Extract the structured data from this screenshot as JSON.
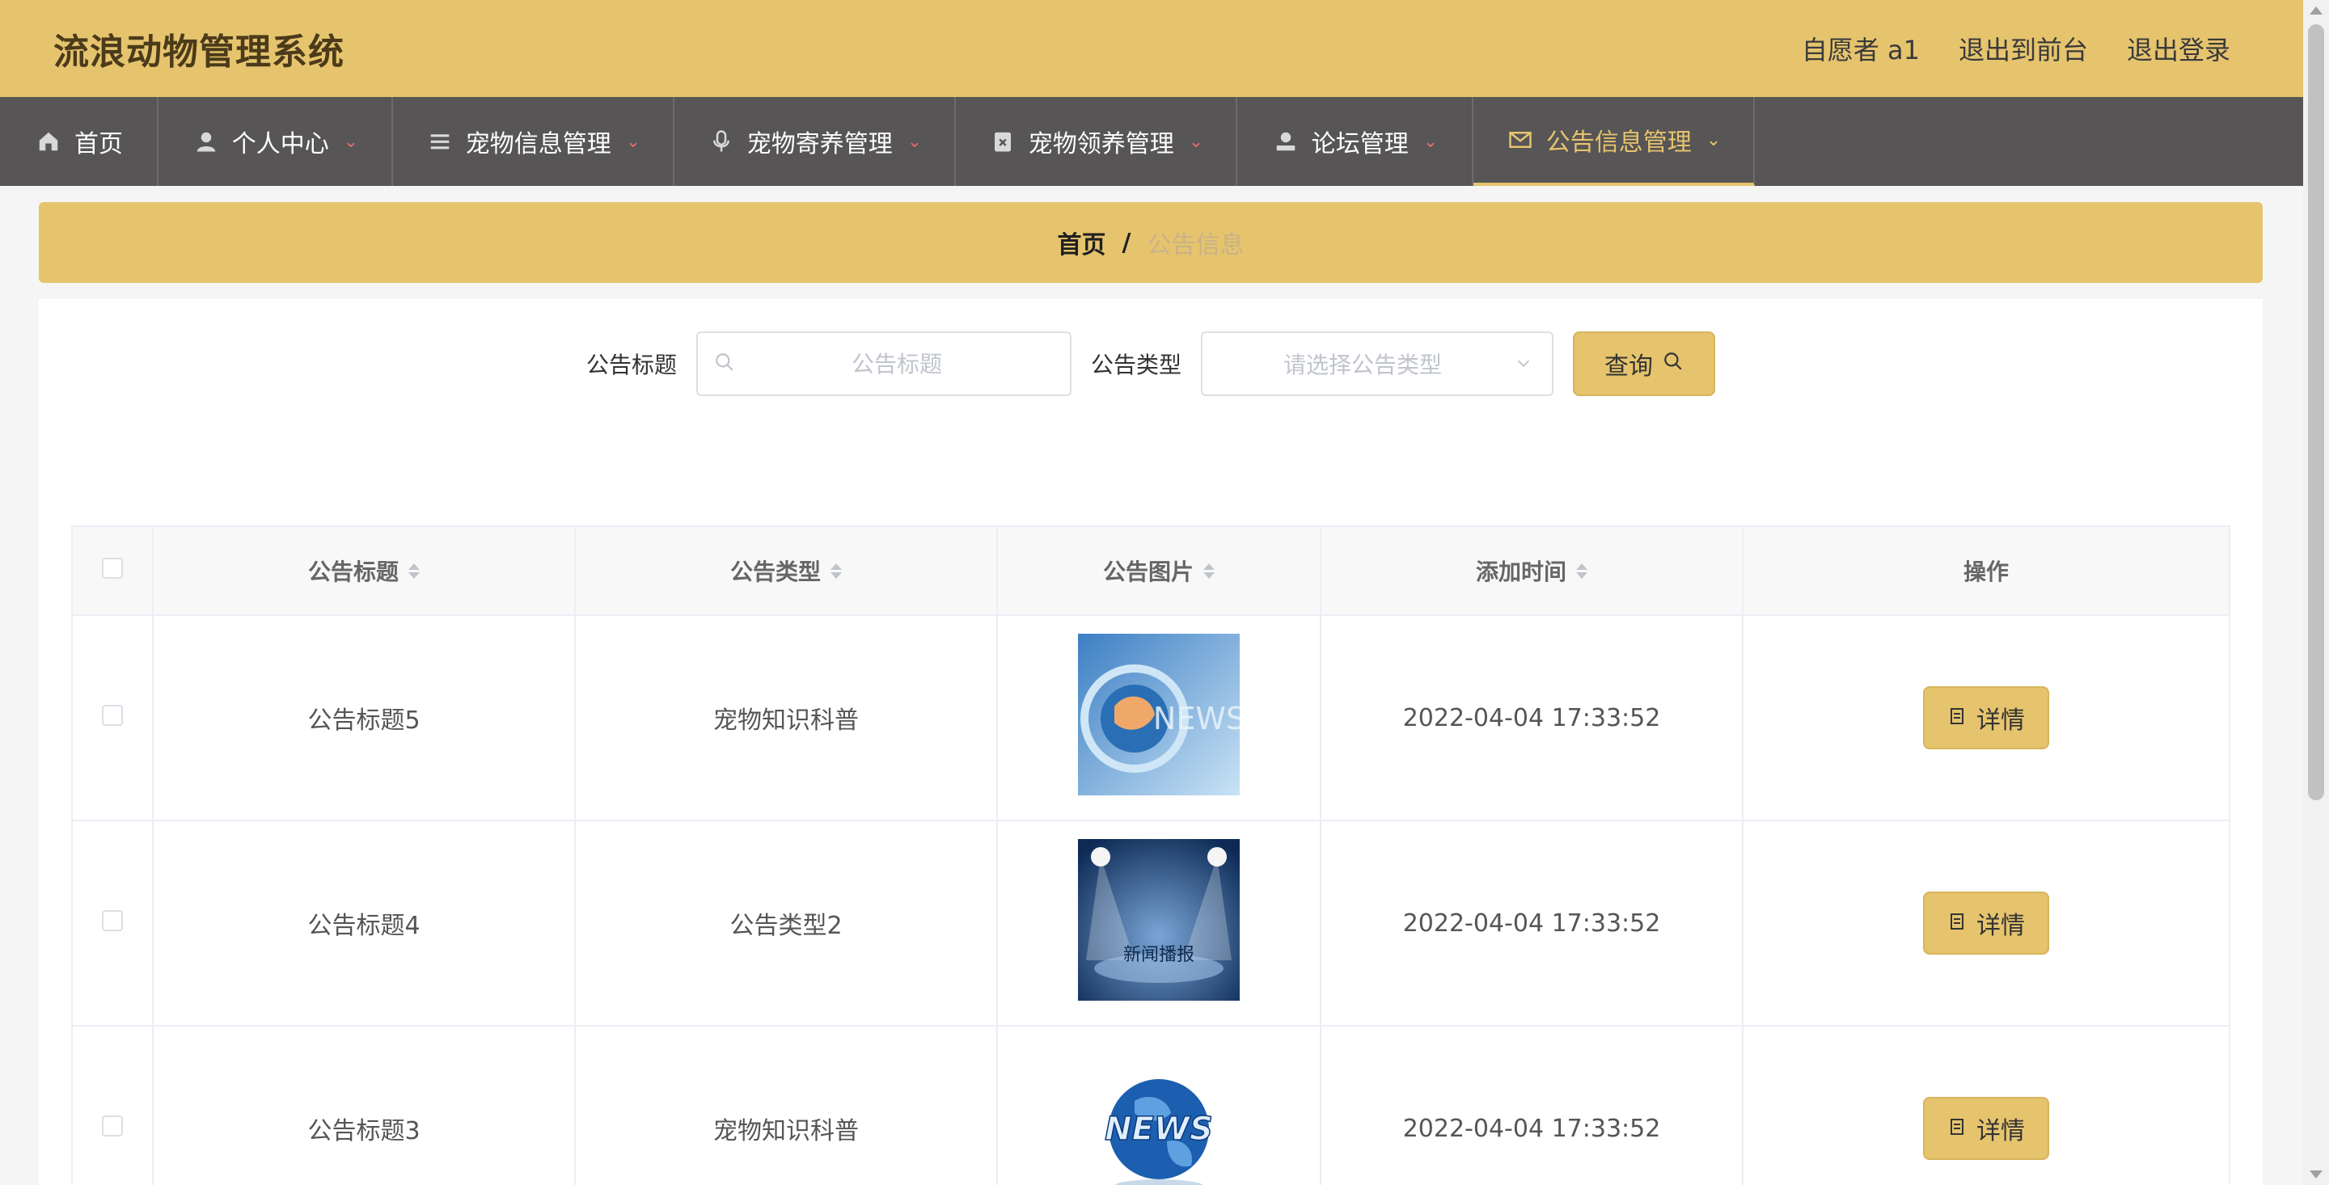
{
  "header": {
    "title": "流浪动物管理系统",
    "user": "自愿者 a1",
    "to_front": "退出到前台",
    "logout": "退出登录"
  },
  "nav": {
    "items": [
      {
        "label": "首页",
        "icon": "home-icon",
        "has_dropdown": false
      },
      {
        "label": "个人中心",
        "icon": "user-icon",
        "has_dropdown": true
      },
      {
        "label": "宠物信息管理",
        "icon": "list-icon",
        "has_dropdown": true
      },
      {
        "label": "宠物寄养管理",
        "icon": "microphone-icon",
        "has_dropdown": true
      },
      {
        "label": "宠物领养管理",
        "icon": "clipboard-icon",
        "has_dropdown": true
      },
      {
        "label": "论坛管理",
        "icon": "user-group-icon",
        "has_dropdown": true
      },
      {
        "label": "公告信息管理",
        "icon": "mail-icon",
        "has_dropdown": true,
        "active": true
      }
    ]
  },
  "breadcrumb": {
    "home": "首页",
    "separator": "/",
    "current": "公告信息"
  },
  "search": {
    "title_label": "公告标题",
    "title_placeholder": "公告标题",
    "type_label": "公告类型",
    "type_placeholder": "请选择公告类型",
    "query_label": "查询"
  },
  "table": {
    "headers": {
      "title": "公告标题",
      "type": "公告类型",
      "image": "公告图片",
      "time": "添加时间",
      "action": "操作"
    },
    "rows": [
      {
        "title": "公告标题5",
        "type": "宠物知识科普",
        "image": "news-globe-thumbnail",
        "time": "2022-04-04 17:33:52",
        "action": "详情"
      },
      {
        "title": "公告标题4",
        "type": "公告类型2",
        "image": "news-stage-thumbnail",
        "image_text": "新闻播报",
        "time": "2022-04-04 17:33:52",
        "action": "详情"
      },
      {
        "title": "公告标题3",
        "type": "宠物知识科普",
        "image": "news-earth-thumbnail",
        "time": "2022-04-04 17:33:52",
        "action": "详情"
      }
    ]
  },
  "colors": {
    "accent": "#e6c46e",
    "nav_bg": "#575555",
    "nav_active": "#e6c46e"
  }
}
